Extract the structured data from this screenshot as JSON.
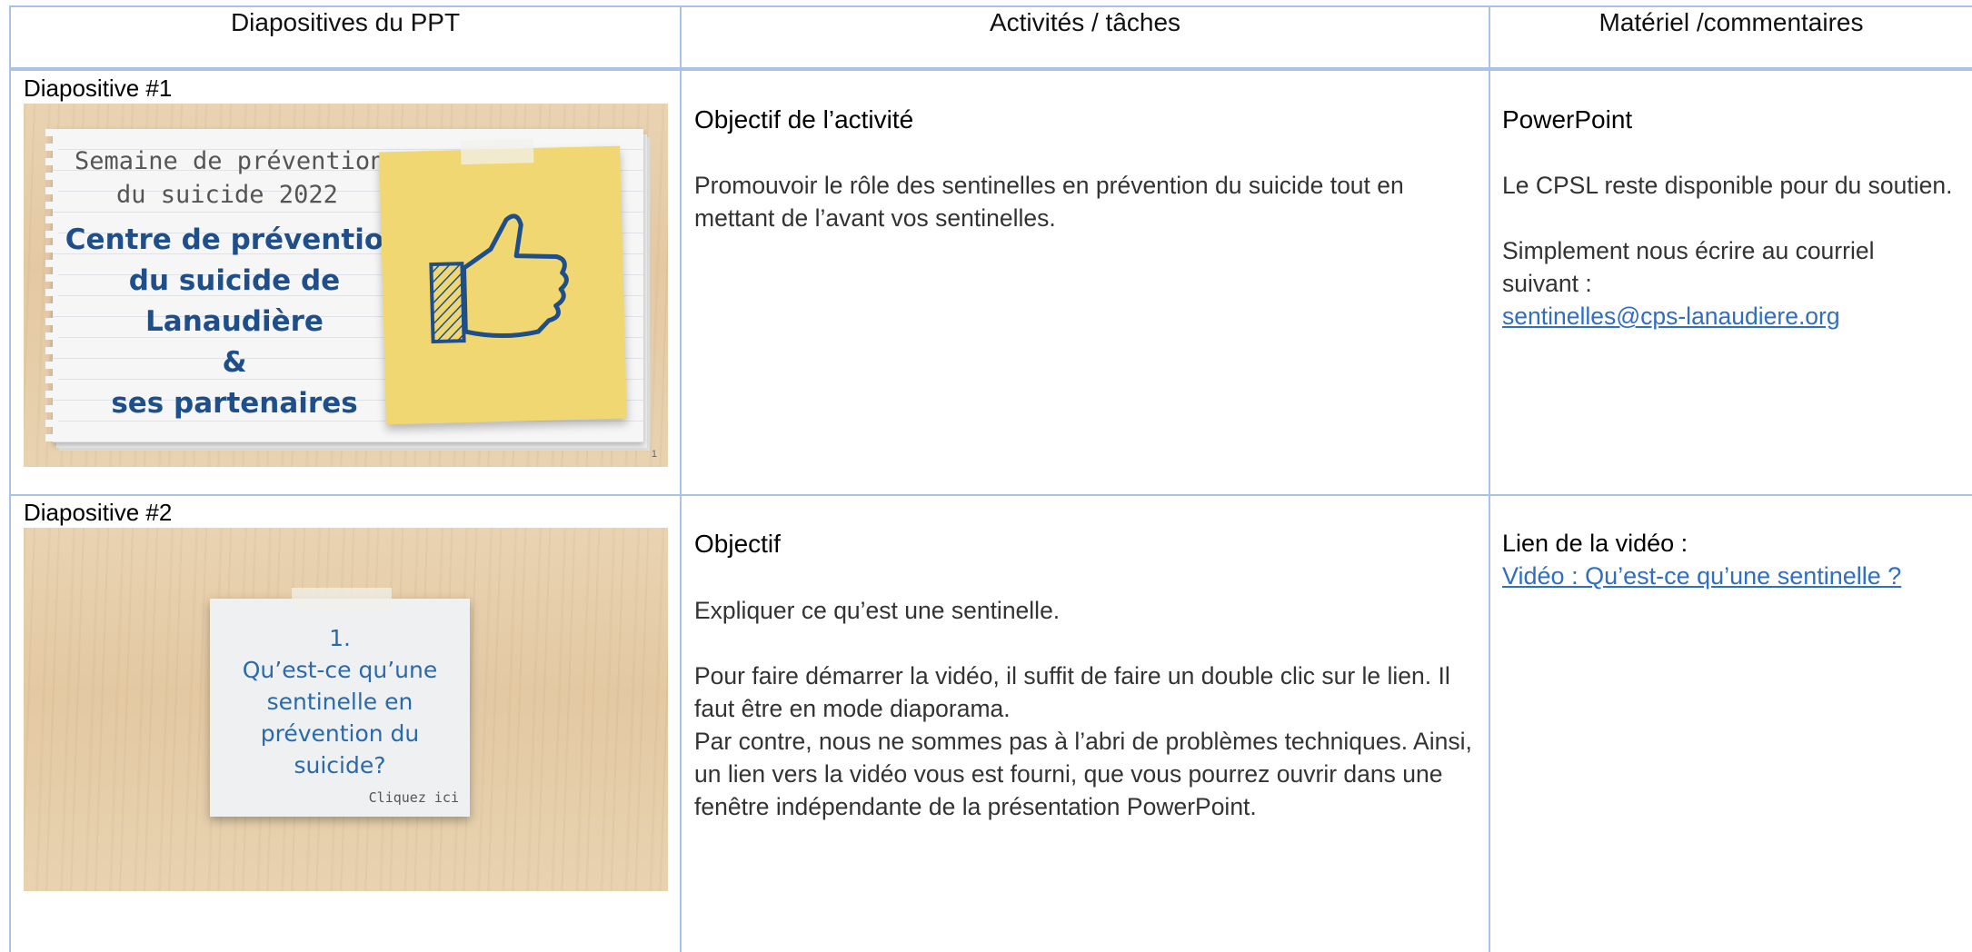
{
  "header": {
    "col1": "Diapositives du PPT",
    "col2": "Activités / tâches",
    "col3": "Matériel /commentaires"
  },
  "rows": [
    {
      "slide_label": "Diapositive #1",
      "slide": {
        "line1": "Semaine de prévention",
        "line2": "du suicide 2022",
        "main1": "Centre de prévention",
        "main2": "du suicide de",
        "main3": "Lanaudière",
        "main4": "&",
        "main5": "ses partenaires",
        "page_number": "1",
        "icon": "thumbs-up-icon"
      },
      "activity_title": "Objectif de l’activité",
      "activity_text": "Promouvoir le rôle des sentinelles en prévention du suicide tout en mettant de l’avant vos sentinelles.",
      "material_title": "PowerPoint",
      "material_text1": "Le CPSL reste disponible pour du soutien.",
      "material_text2": "Simplement nous écrire au courriel suivant :",
      "material_link": "sentinelles@cps-lanaudiere.org"
    },
    {
      "slide_label": "Diapositive #2",
      "slide": {
        "number": "1.",
        "q1": "Qu’est-ce qu’une",
        "q2": "sentinelle en",
        "q3": "prévention du",
        "q4": "suicide?",
        "click": "Cliquez ici"
      },
      "activity_title": "Objectif",
      "activity_text1": "Expliquer ce qu’est une sentinelle.",
      "activity_text2": "Pour faire démarrer la vidéo, il suffit de faire un double clic sur le lien. Il faut être en mode diaporama.",
      "activity_text3": "Par contre, nous ne sommes pas à l’abri de problèmes techniques. Ainsi, un lien vers la vidéo vous est fourni, que vous pourrez ouvrir dans une fenêtre indépendante de la présentation PowerPoint.",
      "material_title": "Lien de la vidéo :",
      "material_link": "Vidéo : Qu’est-ce qu’une sentinelle ?"
    }
  ],
  "colors": {
    "grid": "#a9c3e6",
    "link": "#2f6ec3",
    "sticky": "#f1d772",
    "slide_blue": "#1f4f8a"
  }
}
